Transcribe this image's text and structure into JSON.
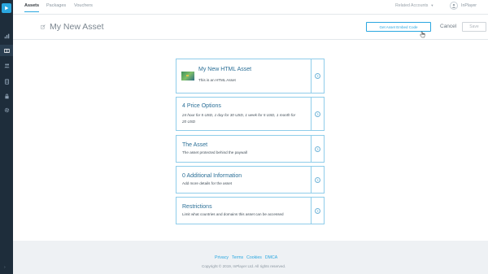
{
  "nav": {
    "tabs": [
      {
        "label": "Assets",
        "active": true
      },
      {
        "label": "Packages",
        "active": false
      },
      {
        "label": "Vouchers",
        "active": false
      }
    ],
    "related_accounts": "Related Accounts",
    "account_name": "InPlayer"
  },
  "header": {
    "title": "My New Asset",
    "embed_button": "Get Asset Embed Code",
    "cancel_button": "Cancel",
    "save_button": "Save"
  },
  "cards": [
    {
      "title": "My New HTML Asset",
      "desc": "This is an HTML Asset"
    },
    {
      "title": "4 Price Options",
      "desc": "24 hour for 5 USD, 1 day for 30 USD, 1 week for 5 USD, 1 month for 20 USD"
    },
    {
      "title": "The Asset",
      "desc": "The asset protected behind the paywall"
    },
    {
      "title": "0 Additional Information",
      "desc": "Add more details for the asset"
    },
    {
      "title": "Restrictions",
      "desc": "Limit what countries and domains this asset can be accessed"
    }
  ],
  "footer": {
    "links": [
      "Privacy",
      "Terms",
      "Cookies",
      "DMCA"
    ],
    "copyright": "Copyright © 2019, InPlayer Ltd. All rights reserved."
  },
  "sidebar": {
    "icons": [
      "play-logo-icon",
      "analytics-icon",
      "assets-icon",
      "audience-icon",
      "payments-icon",
      "lock-icon",
      "settings-icon"
    ],
    "collapse": "›"
  },
  "colors": {
    "accent": "#2aa7e0",
    "sidebar": "#1e2d3b",
    "card_border": "#8fcdea",
    "footer_bg": "#eef1f4"
  }
}
